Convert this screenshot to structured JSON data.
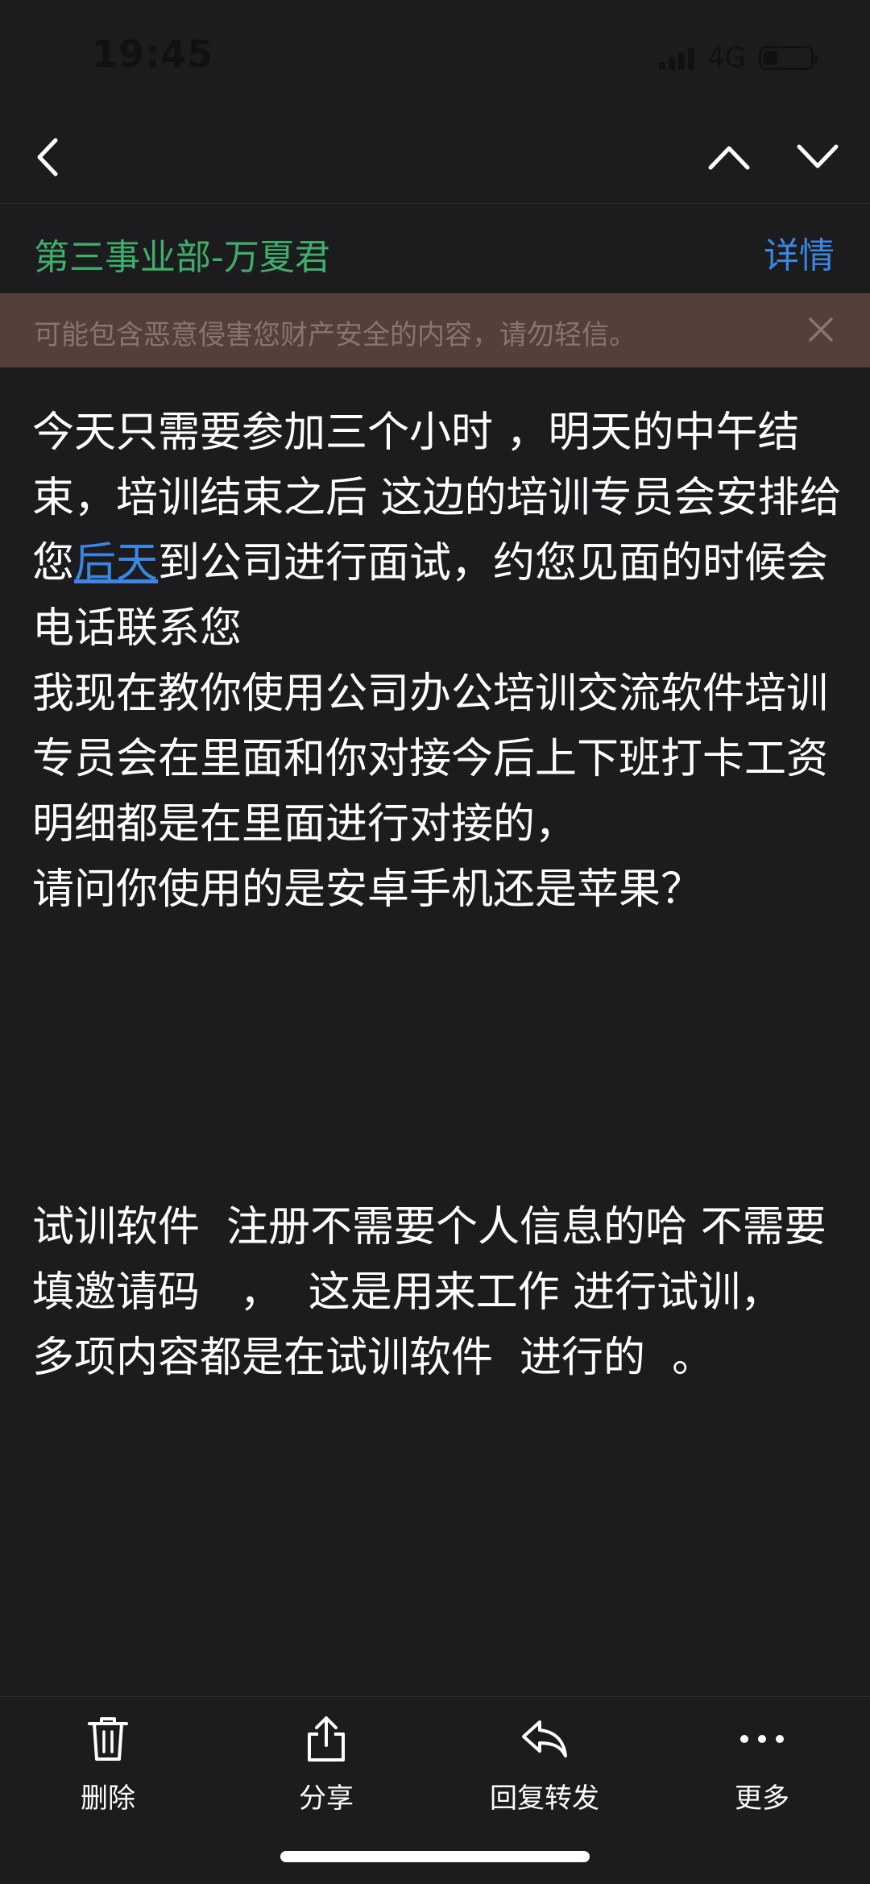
{
  "status_bar": {
    "time": "19:45",
    "network": "4G",
    "battery_level": 0.3
  },
  "nav": {
    "back_icon": "chevron-left-icon",
    "prev_icon": "chevron-up-icon",
    "next_icon": "chevron-down-icon"
  },
  "sender": {
    "name": "第三事业部-万夏君",
    "details_label": "详情",
    "name_color": "#3fae6b",
    "link_color": "#3a86e0"
  },
  "warning": {
    "text": "可能包含恶意侵害您财产安全的内容，请勿轻信。",
    "background": "#54403b",
    "close_icon": "close-icon"
  },
  "message": {
    "para1_before": "今天只需要参加三个小时 ，明天的中午结束，培训结束之后 这边的培训专员会安排给您",
    "para1_link": "后天",
    "para1_after": "到公司进行面试，约您见面的时候会电话联系您\n我现在教你使用公司办公培训交流软件培训专员会在里面和你对接今后上下班打卡工资明细都是在里面进行对接的，\n请问你使用的是安卓手机还是苹果？",
    "para2": "试训软件  注册不需要个人信息的哈 不需要填邀请码   ，  这是用来工作 进行试训，    多项内容都是在试训软件  进行的  。"
  },
  "toolbar": {
    "delete_label": "删除",
    "share_label": "分享",
    "reply_label": "回复转发",
    "more_label": "更多"
  }
}
